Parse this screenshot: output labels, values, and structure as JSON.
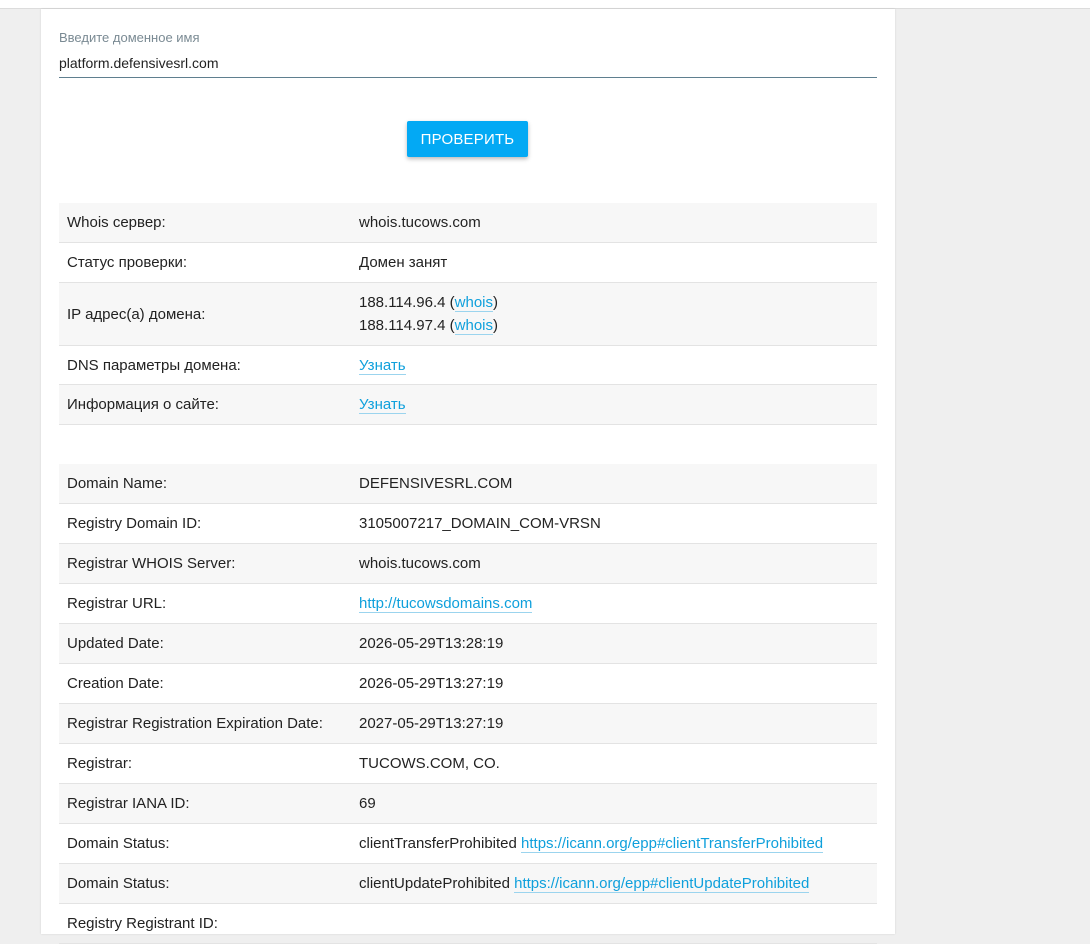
{
  "search": {
    "label": "Введите доменное имя",
    "value": "platform.defensivesrl.com",
    "button_label": "ПРОВЕРИТЬ"
  },
  "summary": {
    "whois_server_label": "Whois сервер:",
    "whois_server_value": "whois.tucows.com",
    "status_label": "Статус проверки:",
    "status_value": "Домен занят",
    "ip_label": "IP адрес(а) домена:",
    "ips": [
      {
        "ip": "188.114.96.4",
        "link": "whois"
      },
      {
        "ip": "188.114.97.4",
        "link": "whois"
      }
    ],
    "dns_label": "DNS параметры домена:",
    "dns_link": "Узнать",
    "site_info_label": "Информация о сайте:",
    "site_info_link": "Узнать"
  },
  "whois": {
    "rows": [
      {
        "label": "Domain Name:",
        "value": "DEFENSIVESRL.COM"
      },
      {
        "label": "Registry Domain ID:",
        "value": "3105007217_DOMAIN_COM-VRSN"
      },
      {
        "label": "Registrar WHOIS Server:",
        "value": "whois.tucows.com"
      },
      {
        "label": "Registrar URL:",
        "link": "http://tucowsdomains.com"
      },
      {
        "label": "Updated Date:",
        "value": "2026-05-29T13:28:19"
      },
      {
        "label": "Creation Date:",
        "value": "2026-05-29T13:27:19"
      },
      {
        "label": "Registrar Registration Expiration Date:",
        "value": "2027-05-29T13:27:19"
      },
      {
        "label": "Registrar:",
        "value": "TUCOWS.COM, CO."
      },
      {
        "label": "Registrar IANA ID:",
        "value": "69"
      },
      {
        "label": "Domain Status:",
        "value": "clientTransferProhibited",
        "link": "https://icann.org/epp#clientTransferProhibited"
      },
      {
        "label": "Domain Status:",
        "value": "clientUpdateProhibited",
        "link": "https://icann.org/epp#clientUpdateProhibited"
      },
      {
        "label": "Registry Registrant ID:",
        "value": ""
      }
    ]
  },
  "colors": {
    "accent": "#03a9f4",
    "link": "#0fa0dc"
  }
}
